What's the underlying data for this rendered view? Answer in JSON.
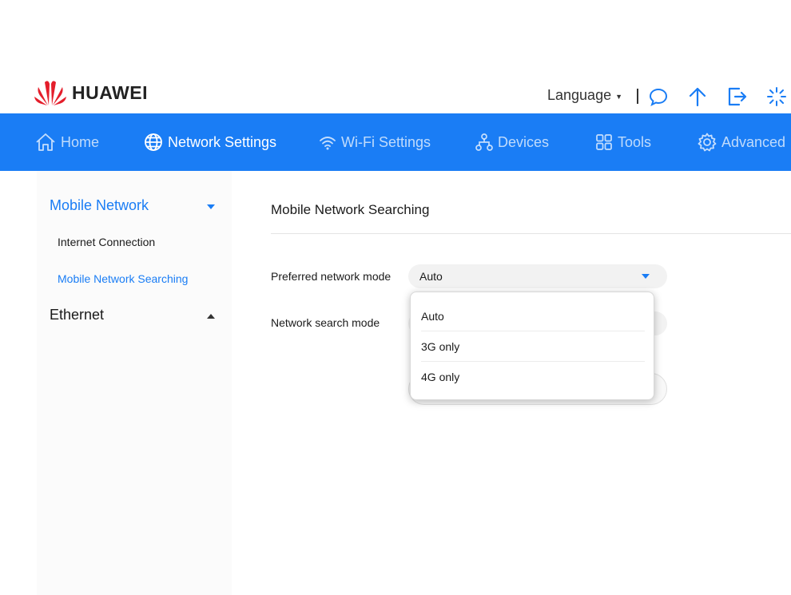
{
  "brand": {
    "name": "HUAWEI",
    "logo_color": "#e41e2b"
  },
  "header": {
    "language_label": "Language",
    "icons": [
      "message-icon",
      "upload-arrow-icon",
      "logout-icon",
      "loading-spinner-icon"
    ]
  },
  "nav": {
    "accent": "#1a7df5",
    "items": [
      {
        "label": "Home",
        "icon": "home-icon"
      },
      {
        "label": "Network Settings",
        "icon": "globe-icon",
        "active": true
      },
      {
        "label": "Wi-Fi Settings",
        "icon": "wifi-icon"
      },
      {
        "label": "Devices",
        "icon": "devices-icon"
      },
      {
        "label": "Tools",
        "icon": "tools-icon"
      },
      {
        "label": "Advanced",
        "icon": "gear-icon"
      }
    ]
  },
  "sidebar": {
    "groups": [
      {
        "label": "Mobile Network",
        "expanded": true,
        "items": [
          {
            "label": "Internet Connection"
          },
          {
            "label": "Mobile Network Searching",
            "active": true
          }
        ]
      },
      {
        "label": "Ethernet",
        "expanded": false,
        "items": []
      }
    ]
  },
  "main": {
    "title": "Mobile Network Searching",
    "fields": [
      {
        "label": "Preferred network mode",
        "value": "Auto"
      },
      {
        "label": "Network search mode"
      }
    ],
    "dropdown": {
      "options": [
        "Auto",
        "3G only",
        "4G only"
      ]
    }
  }
}
